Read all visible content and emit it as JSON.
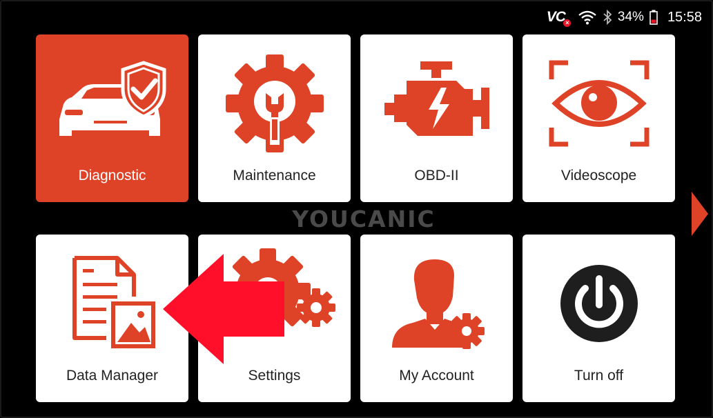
{
  "status_bar": {
    "vci": "VC",
    "vci_badge": "×",
    "battery": "34%",
    "time": "15:58"
  },
  "tiles": [
    {
      "label": "Diagnostic",
      "icon": "car-shield-check-icon",
      "active": true
    },
    {
      "label": "Maintenance",
      "icon": "gear-wrench-icon",
      "active": false
    },
    {
      "label": "OBD-II",
      "icon": "engine-bolt-icon",
      "active": false
    },
    {
      "label": "Videoscope",
      "icon": "eye-scan-icon",
      "active": false
    },
    {
      "label": "Data Manager",
      "icon": "document-image-icon",
      "active": false
    },
    {
      "label": "Settings",
      "icon": "gears-icon",
      "active": false
    },
    {
      "label": "My Account",
      "icon": "user-gear-icon",
      "active": false
    },
    {
      "label": "Turn off",
      "icon": "power-icon",
      "active": false
    }
  ],
  "watermark": "YOUCANIC",
  "colors": {
    "accent": "#df4327",
    "background": "#000000",
    "tile": "#ffffff",
    "pointer_arrow": "#ff0f2a"
  }
}
